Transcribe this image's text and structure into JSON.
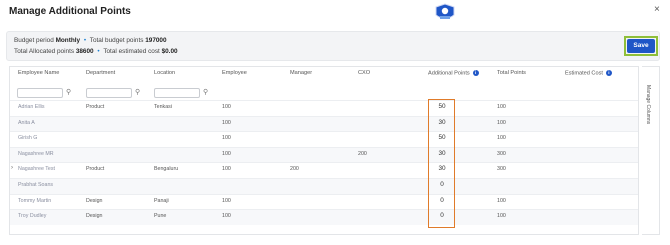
{
  "dialog": {
    "title": "Manage Additional Points",
    "close_glyph": "×"
  },
  "summary": {
    "line1": [
      {
        "label": "Budget period",
        "value": "Monthly"
      },
      {
        "label": "Total budget points",
        "value": "197000"
      }
    ],
    "line2": [
      {
        "label": "Total Allocated points",
        "value": "38600"
      },
      {
        "label": "Total estimated cost",
        "value": "$0.00"
      }
    ]
  },
  "toolbar": {
    "save_label": "Save"
  },
  "table": {
    "columns": [
      "Employee Name",
      "Department",
      "Location",
      "Employee",
      "Manager",
      "CXO",
      "Additional Points",
      "Total Points",
      "Estimated Cost"
    ],
    "rows": [
      {
        "name": "Adrian Ellis",
        "department": "Product",
        "location": "Tenkasi",
        "employee": "100",
        "manager": "",
        "cxo": "",
        "additional": "50",
        "total": "100",
        "cost": ""
      },
      {
        "name": "Anita A",
        "department": "",
        "location": "",
        "employee": "100",
        "manager": "",
        "cxo": "",
        "additional": "30",
        "total": "100",
        "cost": ""
      },
      {
        "name": "Girish G",
        "department": "",
        "location": "",
        "employee": "100",
        "manager": "",
        "cxo": "",
        "additional": "50",
        "total": "100",
        "cost": ""
      },
      {
        "name": "Nagashree MR",
        "department": "",
        "location": "",
        "employee": "100",
        "manager": "",
        "cxo": "200",
        "additional": "30",
        "total": "300",
        "cost": ""
      },
      {
        "name": "Nagashree Test",
        "department": "Product",
        "location": "Bengaluru",
        "employee": "100",
        "manager": "200",
        "cxo": "",
        "additional": "30",
        "total": "300",
        "cost": ""
      },
      {
        "name": "Prabhat Soans",
        "department": "",
        "location": "",
        "employee": "",
        "manager": "",
        "cxo": "",
        "additional": "0",
        "total": "",
        "cost": ""
      },
      {
        "name": "Tommy Martin",
        "department": "Design",
        "location": "Panaji",
        "employee": "100",
        "manager": "",
        "cxo": "",
        "additional": "0",
        "total": "100",
        "cost": ""
      },
      {
        "name": "Troy Dudley",
        "department": "Design",
        "location": "Pune",
        "employee": "100",
        "manager": "",
        "cxo": "",
        "additional": "0",
        "total": "100",
        "cost": ""
      }
    ]
  },
  "side_panel": {
    "label": "Manage Columns"
  },
  "icons": {
    "filter": "filter-icon",
    "info": "info-icon",
    "chevron": "chevron-right-icon",
    "columns": "columns-icon"
  },
  "colors": {
    "accent": "#1f56c7",
    "highlight_outline": "#e07b2a",
    "save_outline": "#8fbf3a"
  }
}
